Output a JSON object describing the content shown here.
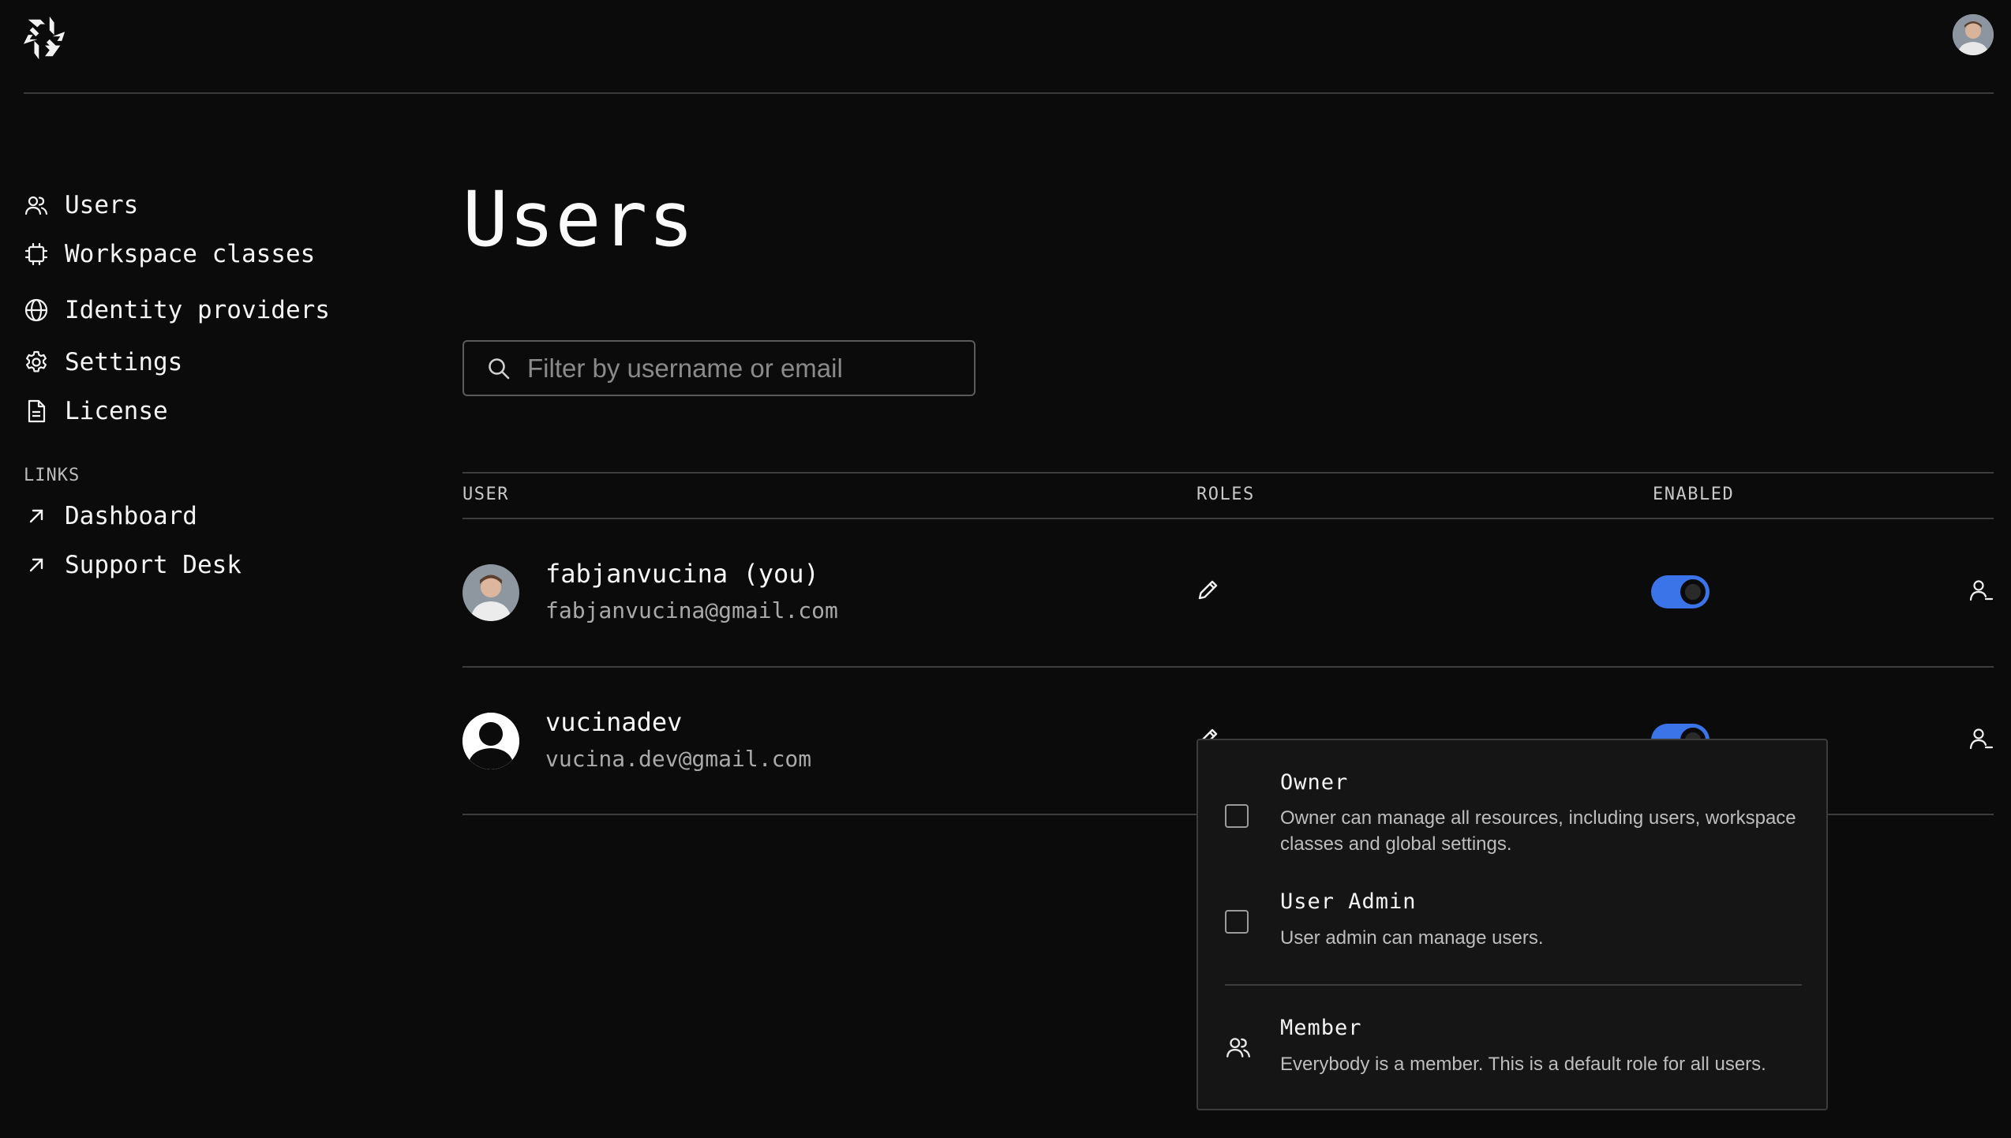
{
  "header": {
    "logo_icon": "gitpod-logo-icon",
    "avatar_icon": "user-avatar"
  },
  "sidebar": {
    "items": [
      {
        "label": "Users",
        "icon": "users-icon"
      },
      {
        "label": "Workspace classes",
        "icon": "chip-icon"
      },
      {
        "label": "Identity providers",
        "icon": "globe-icon"
      },
      {
        "label": "Settings",
        "icon": "gear-icon"
      },
      {
        "label": "License",
        "icon": "document-icon"
      }
    ],
    "links_heading": "LINKS",
    "links": [
      {
        "label": "Dashboard",
        "icon": "arrow-up-right-icon"
      },
      {
        "label": "Support Desk",
        "icon": "arrow-up-right-icon"
      }
    ]
  },
  "main": {
    "title": "Users",
    "search": {
      "placeholder": "Filter by username or email",
      "value": ""
    },
    "columns": {
      "user": "USER",
      "roles": "ROLES",
      "enabled": "ENABLED"
    },
    "users": [
      {
        "name": "fabjanvucina (you)",
        "email": "fabjanvucina@gmail.com",
        "enabled": true
      },
      {
        "name": "vucinadev",
        "email": "vucina.dev@gmail.com",
        "enabled": true
      }
    ]
  },
  "roles_popup": {
    "roles": [
      {
        "title": "Owner",
        "description": "Owner can manage all resources, including users, workspace classes and global settings.",
        "checked": false
      },
      {
        "title": "User Admin",
        "description": "User admin can manage users.",
        "checked": false
      }
    ],
    "member": {
      "title": "Member",
      "description": "Everybody is a member. This is a default role for all users.",
      "icon": "users-icon"
    }
  },
  "colors": {
    "accent": "#3b73e8",
    "background": "#0b0b0b"
  }
}
